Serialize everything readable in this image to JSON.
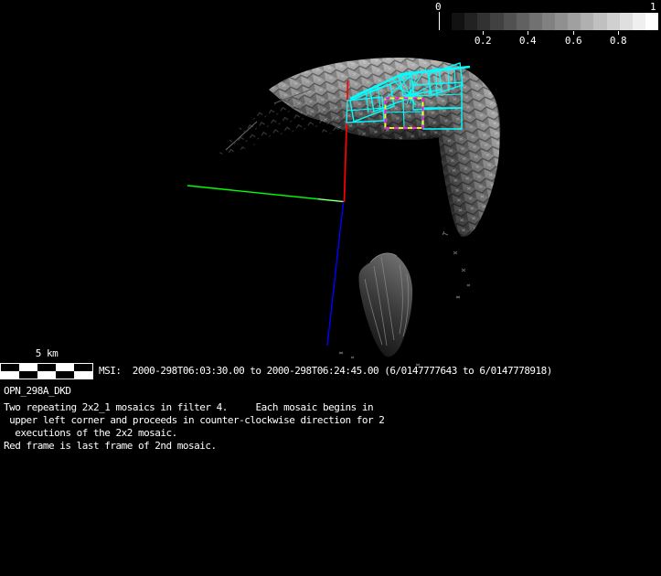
{
  "window": {
    "background": "#000000",
    "text_color": "#ffffff"
  },
  "colorbar": {
    "min_label": "0",
    "max_label": "1",
    "min_value": 0,
    "max_value": 1,
    "tick_labels": [
      "0.2",
      "0.4",
      "0.6",
      "0.8"
    ],
    "steps": 16,
    "start_color": "#121212",
    "end_color": "#ffffff"
  },
  "scale_bar": {
    "label": "5 km",
    "segments": 5,
    "rows": 2,
    "colors": [
      "#000000",
      "#ffffff"
    ]
  },
  "status_line": {
    "text": "MSI:  2000-298T06:03:30.00 to 2000-298T06:24:45.00 (6/0147777643 to 6/0147778918)"
  },
  "caption": {
    "sequence_id": "OPN_298A_DKD",
    "lines": [
      "Two repeating 2x2_1 mosaics in filter 4.     Each mosaic begins in",
      " upper left corner and proceeds in counter-clockwise direction for 2",
      "  executions of the 2x2 mosaic.",
      "Red frame is last frame of 2nd mosaic."
    ]
  },
  "scene": {
    "kind": "3d-asteroid-shape-model-view",
    "instrument": "MSI",
    "mosaic_frame_color": "#00ffff",
    "highlight_frame_dash_colors": [
      "#ff00ff",
      "#ffff00"
    ],
    "axes": {
      "x_axis_color": "#ff0000",
      "y_axis_color": "#00ff00",
      "z_axis_color": "#0000ff"
    }
  }
}
